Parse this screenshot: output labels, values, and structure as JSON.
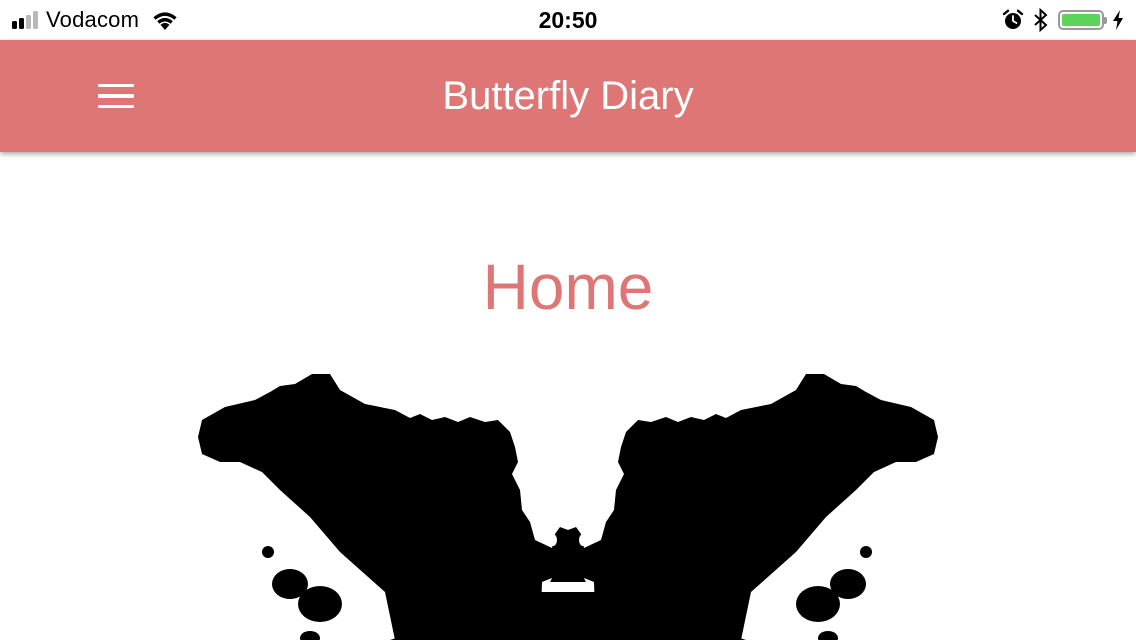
{
  "status_bar": {
    "carrier": "Vodacom",
    "time": "20:50",
    "signal_bars_filled": 2,
    "signal_bars_total": 4,
    "battery_level": 1.0,
    "icons": [
      "signal-icon",
      "wifi-icon",
      "alarm-icon",
      "bluetooth-icon",
      "battery-icon",
      "charging-icon"
    ]
  },
  "app_bar": {
    "title": "Butterfly Diary",
    "menu_icon": "hamburger-menu-icon",
    "color": "#de7676"
  },
  "page": {
    "title": "Home",
    "title_color": "#de7676",
    "image": "butterfly-inkblot"
  }
}
